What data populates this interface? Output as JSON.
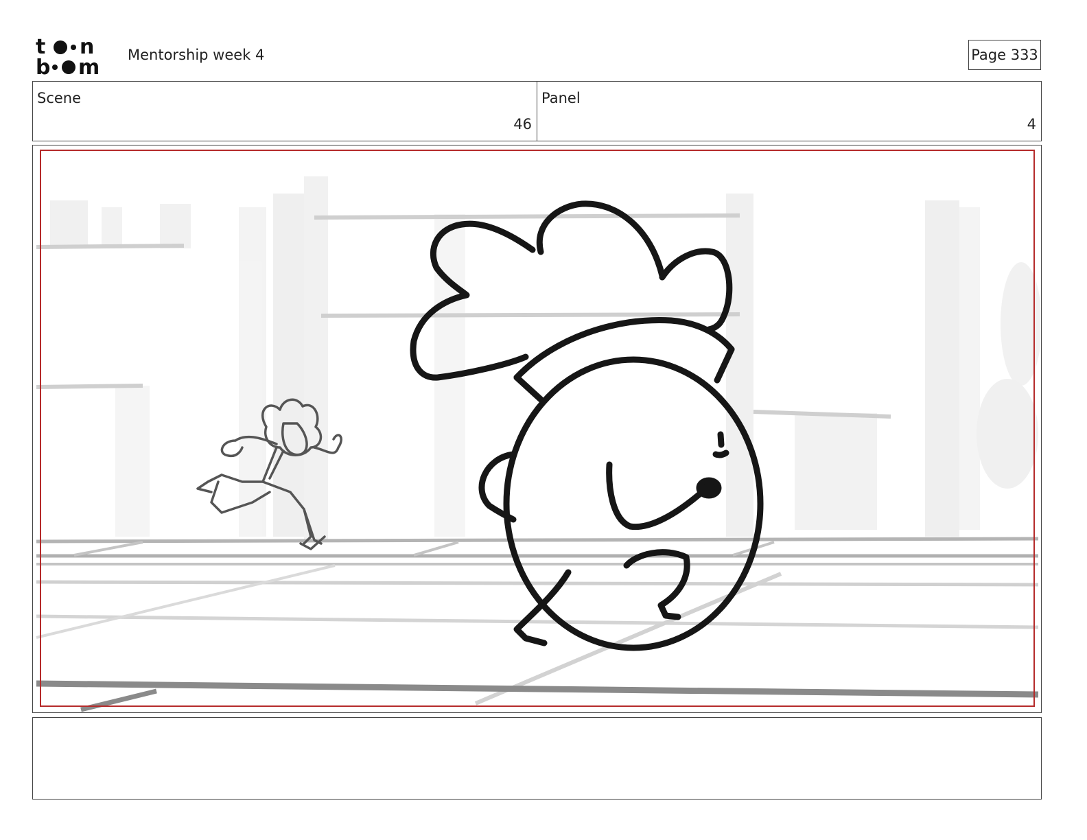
{
  "header": {
    "logo_text": "toon boom",
    "title": "Mentorship week 4",
    "page_label": "Page 333"
  },
  "scene": {
    "label": "Scene",
    "value": "46"
  },
  "panel": {
    "label": "Panel",
    "value": "4"
  },
  "drawing": {
    "description": "rough storyboard sketch",
    "safe_frame_color": "#b52a2a"
  },
  "notes": {
    "text": ""
  }
}
